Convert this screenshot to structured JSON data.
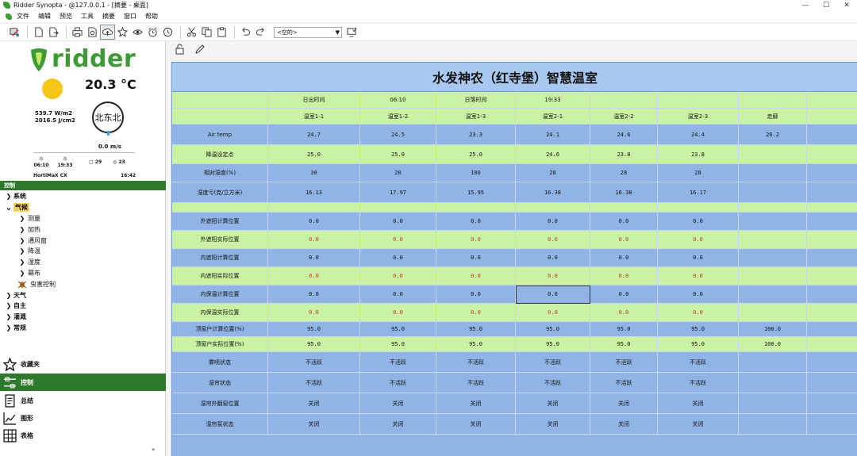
{
  "window": {
    "title": "Ridder Synopta - @127.0.0.1 - [摘要 - 桌面]",
    "controls": [
      "—",
      "☐",
      "✕"
    ]
  },
  "menu": [
    "文件",
    "编辑",
    "预览",
    "工具",
    "摘要",
    "窗口",
    "帮助"
  ],
  "toolbar": {
    "combo_value": "<空的>"
  },
  "brand": {
    "logo_text": "ridder"
  },
  "weather": {
    "temperature": "20.3 °C",
    "radiation": "539.7 W/m2",
    "radiation_sum": "2016.5 J/cm2",
    "wind_direction": "北东北",
    "wind_speed": "0.0 m/s",
    "sunrise": "06:10",
    "sunset": "19:33",
    "stat_a": "29",
    "stat_b": "23",
    "system": "HortiMaX CX",
    "clock": "16:42"
  },
  "nav": {
    "header": "控制",
    "tree": [
      {
        "level": 0,
        "label": "系统",
        "expanded": false
      },
      {
        "level": 0,
        "label": "气候",
        "expanded": true,
        "highlight": true
      },
      {
        "level": 1,
        "label": "测量"
      },
      {
        "level": 1,
        "label": "加热"
      },
      {
        "level": 1,
        "label": "通风窗"
      },
      {
        "level": 1,
        "label": "降温"
      },
      {
        "level": 1,
        "label": "湿度"
      },
      {
        "level": 1,
        "label": "幕布"
      },
      {
        "level": 1,
        "label": "虫害控制",
        "icon": "bug"
      },
      {
        "level": 0,
        "label": "天气",
        "expanded": false
      },
      {
        "level": 0,
        "label": "自主",
        "expanded": false
      },
      {
        "level": 0,
        "label": "灌溉",
        "expanded": false
      },
      {
        "level": 0,
        "label": "常规",
        "expanded": false
      }
    ],
    "bottom": [
      {
        "label": "收藏夹",
        "icon": "star-icon",
        "active": false
      },
      {
        "label": "控制",
        "icon": "control-icon",
        "active": true
      },
      {
        "label": "总结",
        "icon": "summary-icon",
        "active": false
      },
      {
        "label": "图形",
        "icon": "chart-icon",
        "active": false
      },
      {
        "label": "表格",
        "icon": "table-icon",
        "active": false
      }
    ],
    "scroll_mark": "»"
  },
  "table": {
    "title": "水发神农（红寺堡）智慧温室",
    "info_row": [
      "",
      "日出时间",
      "06:10",
      "日落时间",
      "19:33",
      "",
      "",
      "",
      ""
    ],
    "header_row": [
      "",
      "温室1-1",
      "温室1-2",
      "温室1-3",
      "温室2-1",
      "温室2-2",
      "温室2-3",
      "走廊",
      ""
    ],
    "rows": [
      {
        "label": "Air temp",
        "values": [
          "24.7",
          "24.5",
          "23.3",
          "24.1",
          "24.6",
          "24.4",
          "26.2",
          ""
        ],
        "color": "blue"
      },
      {
        "label": "降温设定点",
        "values": [
          "25.0",
          "25.0",
          "25.0",
          "24.6",
          "23.8",
          "23.8",
          "",
          ""
        ],
        "color": "green"
      },
      {
        "label": "相对湿度(%)",
        "values": [
          "30",
          "20",
          "100",
          "28",
          "28",
          "28",
          "",
          ""
        ],
        "color": "blue"
      },
      {
        "label": "湿度亏(克/立方米)",
        "values": [
          "16.13",
          "17.97",
          "15.95",
          "16.38",
          "16.38",
          "16.17",
          "",
          ""
        ],
        "color": "blue"
      },
      {
        "label": "",
        "values": [
          "",
          "",
          "",
          "",
          "",
          "",
          "",
          ""
        ],
        "color": "green"
      },
      {
        "label": "外遮阳计算位置",
        "values": [
          "0.0",
          "0.0",
          "0.0",
          "0.0",
          "0.0",
          "0.0",
          "",
          ""
        ],
        "color": "blue"
      },
      {
        "label": "外遮阳实际位置",
        "values": [
          "0.0",
          "0.0",
          "0.0",
          "0.0",
          "0.0",
          "0.0",
          "",
          ""
        ],
        "color": "green",
        "red": true
      },
      {
        "label": "内遮阳计算位置",
        "values": [
          "0.0",
          "0.0",
          "0.0",
          "0.0",
          "0.0",
          "0.0",
          "",
          ""
        ],
        "color": "blue"
      },
      {
        "label": "内遮阳实际位置",
        "values": [
          "0.0",
          "0.0",
          "0.0",
          "0.0",
          "0.0",
          "0.0",
          "",
          ""
        ],
        "color": "green",
        "red": true
      },
      {
        "label": "内保温计算位置",
        "values": [
          "0.0",
          "0.0",
          "0.0",
          "0.0",
          "0.0",
          "0.0",
          "",
          ""
        ],
        "color": "blue"
      },
      {
        "label": "内保温实际位置",
        "values": [
          "0.0",
          "0.0",
          "0.0",
          "0.0",
          "0.0",
          "0.0",
          "",
          ""
        ],
        "color": "green",
        "red": true
      },
      {
        "label": "顶窗户计算位置(%)",
        "values": [
          "95.0",
          "95.0",
          "95.0",
          "95.0",
          "95.0",
          "95.0",
          "100.0",
          ""
        ],
        "color": "blue"
      },
      {
        "label": "顶窗户实际位置(%)",
        "values": [
          "95.0",
          "95.0",
          "95.0",
          "95.0",
          "95.0",
          "95.0",
          "100.0",
          ""
        ],
        "color": "green"
      },
      {
        "label": "雾喷状态",
        "values": [
          "不活跃",
          "不活跃",
          "不活跃",
          "不活跃",
          "不活跃",
          "不活跃",
          "",
          ""
        ],
        "color": "blue"
      },
      {
        "label": "湿帘状态",
        "values": [
          "不活跃",
          "不活跃",
          "不活跃",
          "不活跃",
          "不活跃",
          "不活跃",
          "",
          ""
        ],
        "color": "blue"
      },
      {
        "label": "湿帘外翻窗位置",
        "values": [
          "关闭",
          "关闭",
          "关闭",
          "关闭",
          "关闭",
          "关闭",
          "",
          ""
        ],
        "color": "blue"
      },
      {
        "label": "湿帘泵状态",
        "values": [
          "关闭",
          "关闭",
          "关闭",
          "关闭",
          "关闭",
          "关闭",
          "",
          ""
        ],
        "color": "blue"
      }
    ],
    "selected_cell": {
      "row": 9,
      "col": 4
    },
    "colors": {
      "blue": "#8fb4e5",
      "green": "#c9f3a3",
      "title": "#a9c8ef",
      "red_text": "#c0392b"
    }
  }
}
